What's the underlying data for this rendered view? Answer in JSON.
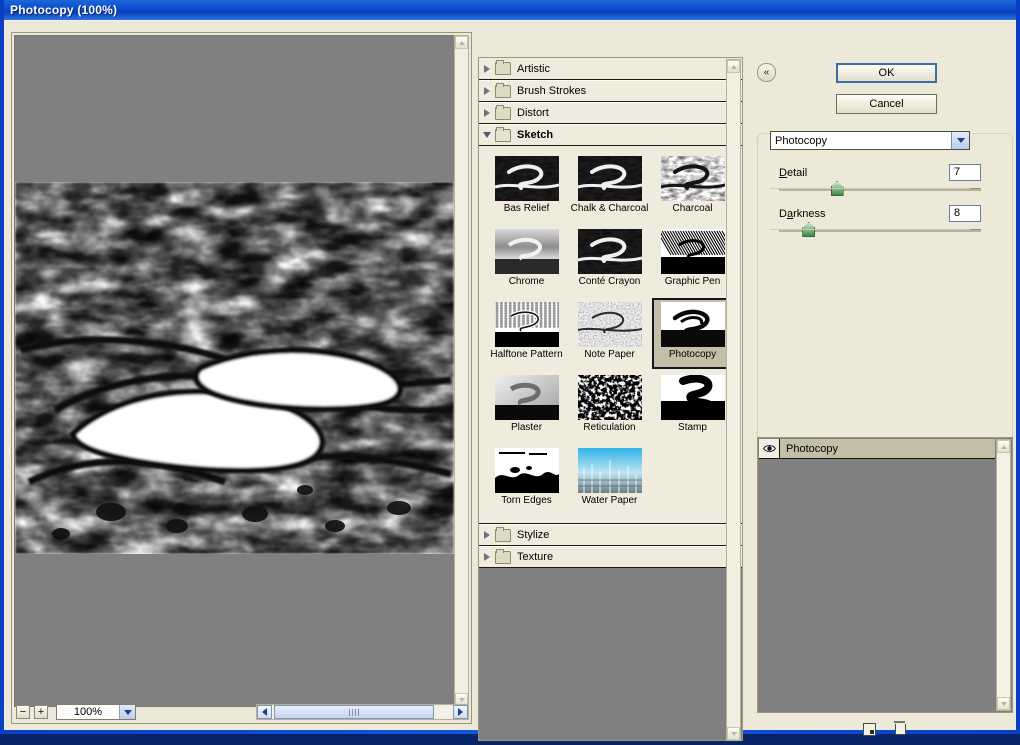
{
  "window": {
    "title": "Photocopy (100%)"
  },
  "preview": {
    "zoom_out_label": "−",
    "zoom_in_label": "+",
    "zoom_value": "100%",
    "scroll_left_icon": "chevron-left-icon",
    "scroll_right_icon": "chevron-right-icon",
    "scroll_up_icon": "chevron-up-icon",
    "scroll_down_icon": "chevron-down-icon",
    "background_color": "#808080"
  },
  "gallery": {
    "categories": [
      {
        "label": "Artistic",
        "expanded": false
      },
      {
        "label": "Brush Strokes",
        "expanded": false
      },
      {
        "label": "Distort",
        "expanded": false
      },
      {
        "label": "Sketch",
        "expanded": true
      },
      {
        "label": "Stylize",
        "expanded": false
      },
      {
        "label": "Texture",
        "expanded": false
      }
    ],
    "filters": [
      {
        "label": "Bas Relief",
        "selected": false
      },
      {
        "label": "Chalk & Charcoal",
        "selected": false
      },
      {
        "label": "Charcoal",
        "selected": false
      },
      {
        "label": "Chrome",
        "selected": false
      },
      {
        "label": "Conté Crayon",
        "selected": false
      },
      {
        "label": "Graphic Pen",
        "selected": false
      },
      {
        "label": "Halftone Pattern",
        "selected": false
      },
      {
        "label": "Note Paper",
        "selected": false
      },
      {
        "label": "Photocopy",
        "selected": true
      },
      {
        "label": "Plaster",
        "selected": false
      },
      {
        "label": "Reticulation",
        "selected": false
      },
      {
        "label": "Stamp",
        "selected": false
      },
      {
        "label": "Torn Edges",
        "selected": false
      },
      {
        "label": "Water Paper",
        "selected": false
      }
    ]
  },
  "controls": {
    "collapse_icon": "«",
    "ok_label": "OK",
    "cancel_label": "Cancel",
    "filter_select_value": "Photocopy",
    "sliders": [
      {
        "label_pre": "D",
        "label_accel": "e",
        "label_post": "tail",
        "label": "Detail",
        "value": "7",
        "percent": 28
      },
      {
        "label_pre": "D",
        "label_accel": "a",
        "label_post": "rkness",
        "label": "Darkness",
        "value": "8",
        "percent": 14
      }
    ]
  },
  "layers": {
    "items": [
      {
        "name": "Photocopy",
        "visible": true,
        "selected": true
      }
    ],
    "eye_icon": "◉",
    "new_layer_icon": "new-effect-layer-icon",
    "delete_icon": "trash-icon"
  },
  "colors": {
    "title_blue": "#0a4bd0",
    "dialog_bg": "#ece9d8",
    "preview_gray": "#808080",
    "selection_tan": "#c3bfa6",
    "slider_green": "#3f8c49",
    "accent_blue": "#3a6ea5"
  }
}
